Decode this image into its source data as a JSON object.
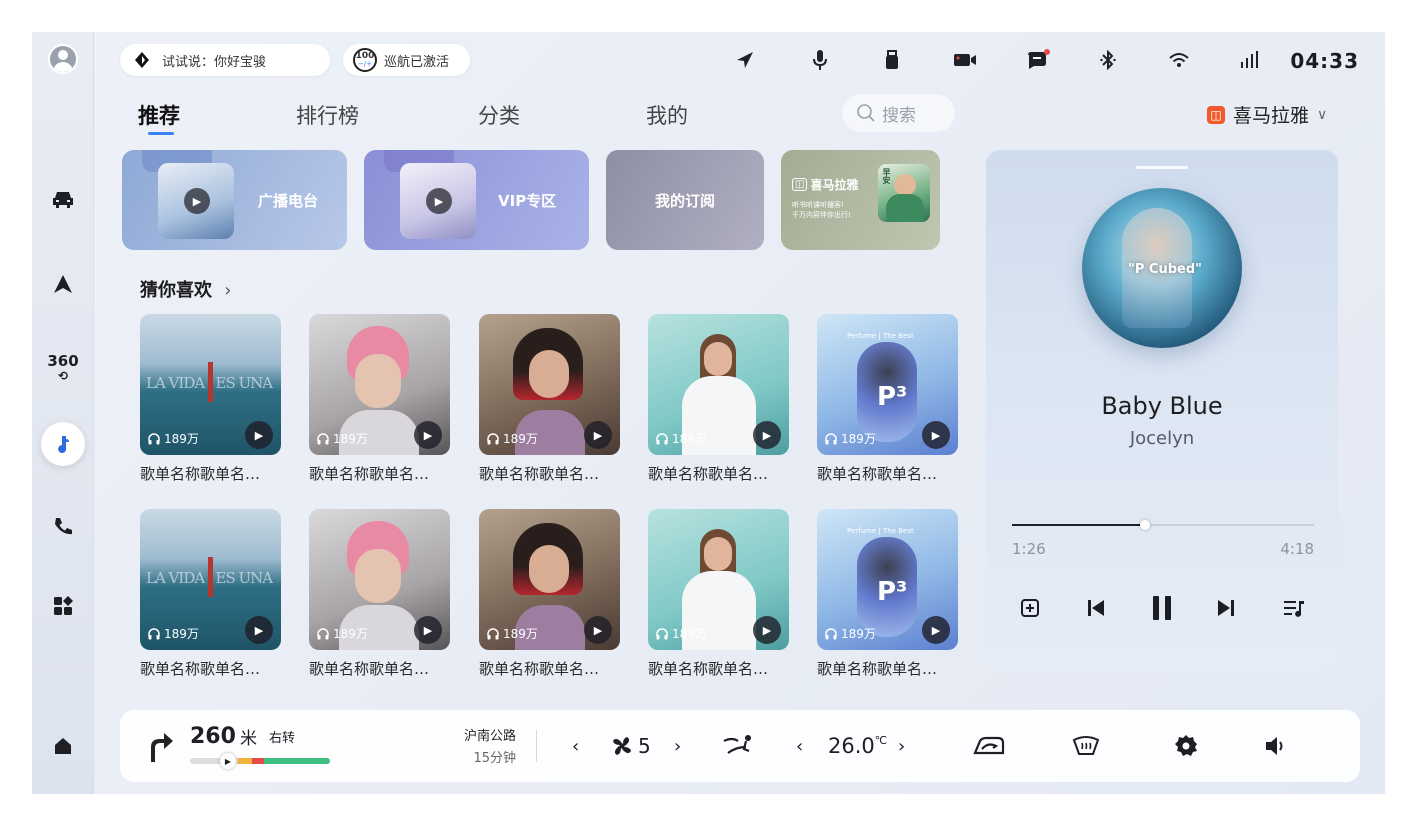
{
  "status_bar": {
    "voice_hint": "试试说：你好宝骏",
    "cruise_badge": "100",
    "cruise_badge_sub": "−/+",
    "cruise_status": "巡航已激活",
    "clock": "04:33"
  },
  "tabs": [
    {
      "label": "推荐",
      "active": true
    },
    {
      "label": "排行榜",
      "active": false
    },
    {
      "label": "分类",
      "active": false
    },
    {
      "label": "我的",
      "active": false
    }
  ],
  "search": {
    "placeholder": "搜索"
  },
  "provider": {
    "name": "喜马拉雅"
  },
  "categories": [
    {
      "label": "广播电台"
    },
    {
      "label": "VIP专区"
    },
    {
      "label": "我的订阅"
    },
    {
      "label": "喜马拉雅",
      "line1": "听书听课听播客!",
      "line2": "千万内容伴你出行!",
      "badge": "早安"
    }
  ],
  "guess_section": {
    "title": "猜你喜欢"
  },
  "playlists": [
    {
      "count": "189万",
      "name": "歌单名称歌单名…"
    },
    {
      "count": "189万",
      "name": "歌单名称歌单名…"
    },
    {
      "count": "189万",
      "name": "歌单名称歌单名…"
    },
    {
      "count": "189万",
      "name": "歌单名称歌单名…"
    },
    {
      "count": "189万",
      "name": "歌单名称歌单名…"
    },
    {
      "count": "189万",
      "name": "歌单名称歌单名…"
    },
    {
      "count": "189万",
      "name": "歌单名称歌单名…"
    },
    {
      "count": "189万",
      "name": "歌单名称歌单名…"
    },
    {
      "count": "189万",
      "name": "歌单名称歌单名…"
    },
    {
      "count": "189万",
      "name": "歌单名称歌单名…"
    }
  ],
  "tile_art_text": {
    "vida_left": "LA VIDA",
    "vida_right": "ES UNA",
    "perfume": "Perfume | The Best",
    "p3": "P³"
  },
  "player": {
    "album_text": "\"P Cubed\"",
    "title": "Baby Blue",
    "artist": "Jocelyn",
    "current_time": "1:26",
    "total_time": "4:18",
    "progress": 0.44
  },
  "bottom_bar": {
    "distance": "260",
    "distance_unit": "米",
    "turn": "右转",
    "road": "沪南公路",
    "eta": "15分钟",
    "fan_level": "5",
    "temperature": "26.0",
    "temp_unit": "℃"
  },
  "colors": {
    "accent": "#3b82f6",
    "brand": "#f15a2b",
    "route_green": "#3fbf7f",
    "route_red": "#e84a4a",
    "route_yellow": "#f2b33d"
  }
}
